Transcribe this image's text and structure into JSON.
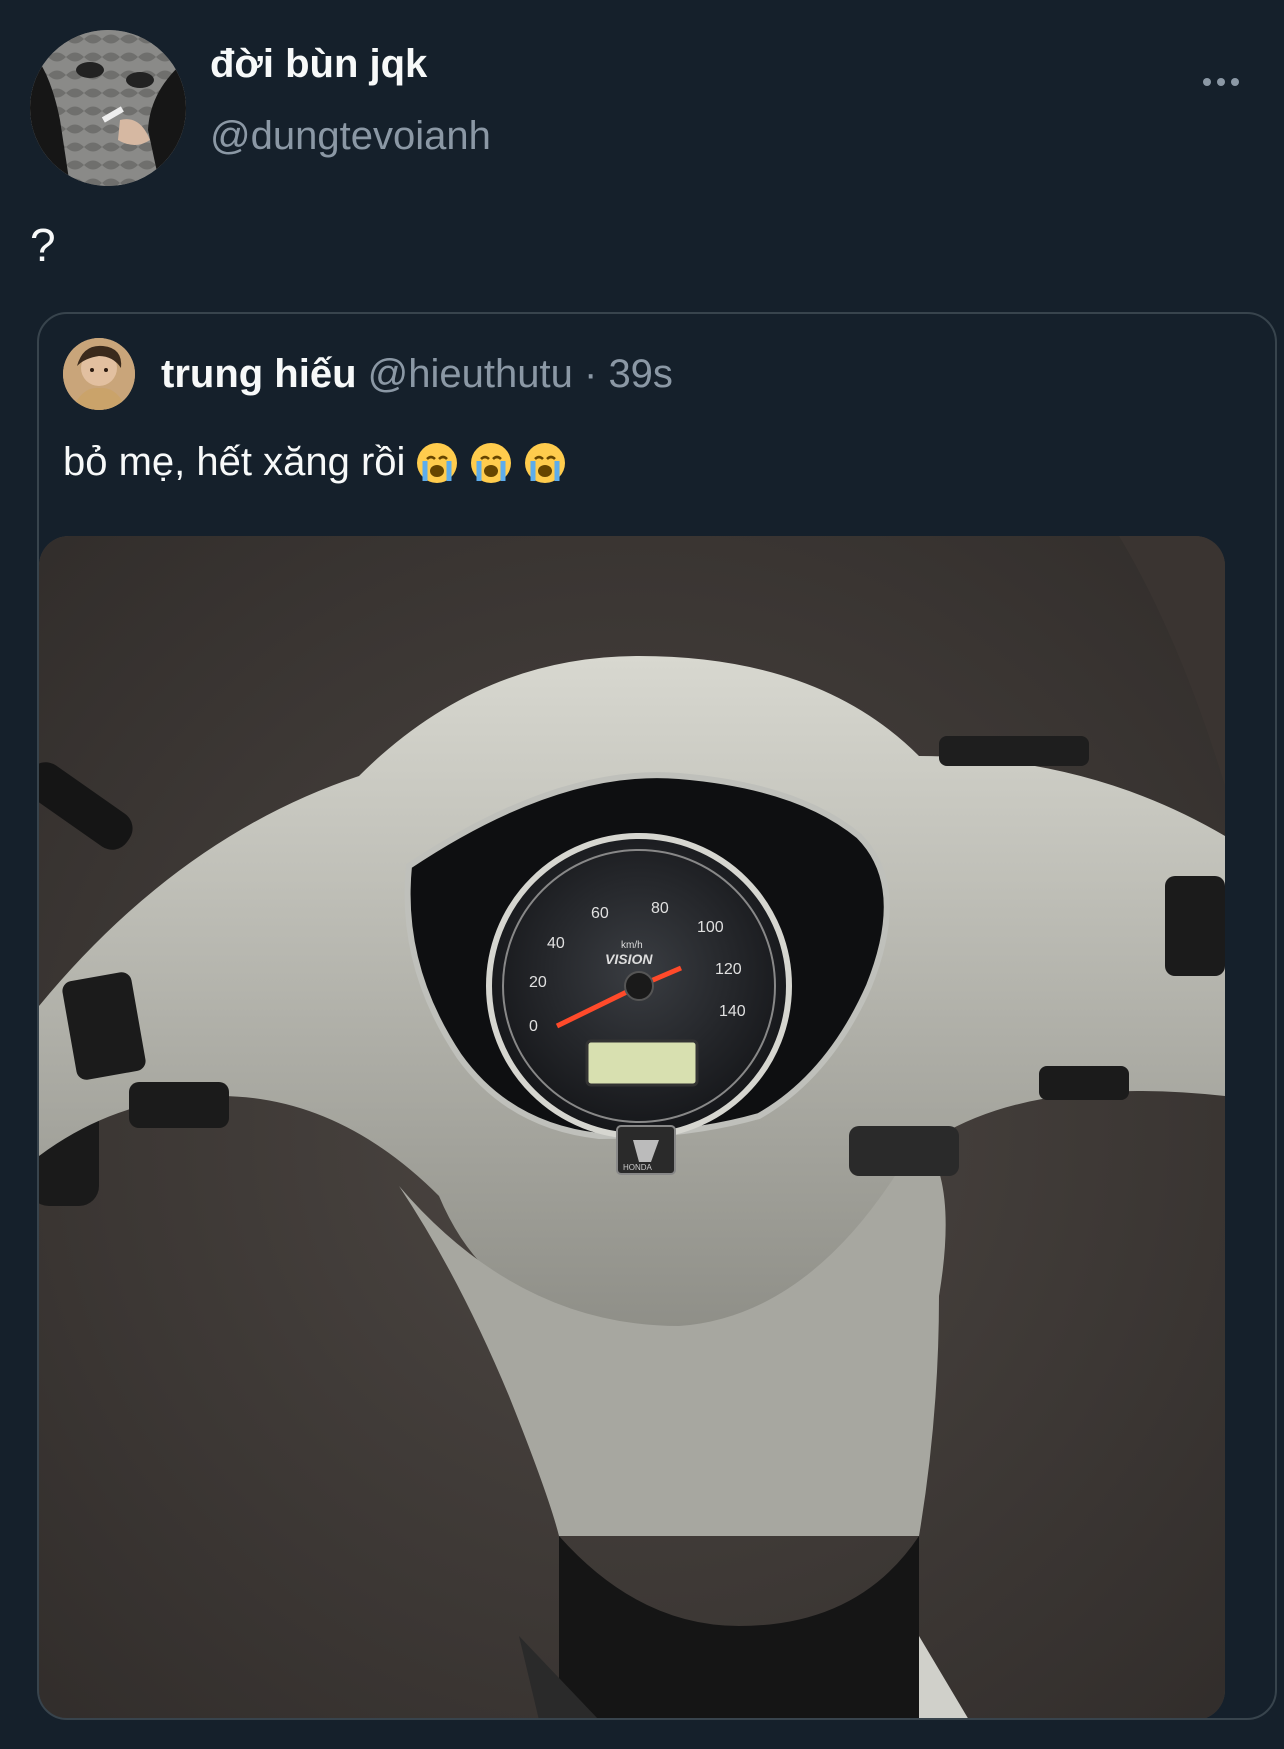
{
  "tweet": {
    "display_name": "đời bùn jqk",
    "handle": "@dungtevoianh",
    "text": "?",
    "avatar_icon": "user-avatar",
    "more_icon": "more-horizontal-icon"
  },
  "quote": {
    "display_name": "trung hiếu",
    "handle": "@hieuthutu",
    "separator": "·",
    "time": "39s",
    "text": "bỏ mẹ, hết xăng rồi",
    "emojis": [
      "loudly-crying-face",
      "loudly-crying-face",
      "loudly-crying-face"
    ],
    "media": {
      "brand": "HONDA",
      "model": "VISION",
      "unit": "km/h",
      "speed_ticks": [
        "0",
        "20",
        "40",
        "60",
        "80",
        "100",
        "120",
        "140"
      ]
    }
  }
}
